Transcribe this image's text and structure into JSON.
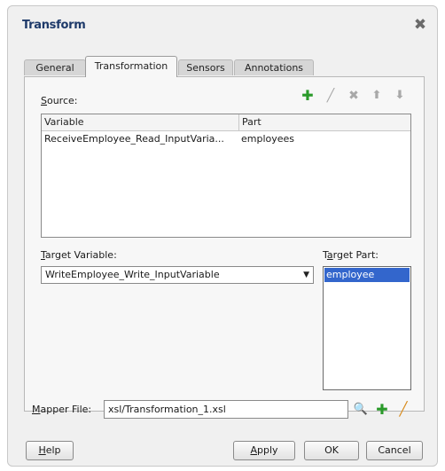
{
  "dialog": {
    "title": "Transform",
    "close_glyph": "✖"
  },
  "tabs": [
    {
      "label": "General"
    },
    {
      "label": "Transformation",
      "active": true
    },
    {
      "label": "Sensors"
    },
    {
      "label": "Annotations"
    }
  ],
  "source": {
    "label_accel": "S",
    "label_rest": "ource:",
    "toolbar": {
      "add_glyph": "✚",
      "edit_glyph": "╱",
      "delete_glyph": "✖",
      "up_glyph": "⬆",
      "down_glyph": "⬇"
    },
    "columns": [
      "Variable",
      "Part"
    ],
    "rows": [
      {
        "variable": "ReceiveEmployee_Read_InputVaria...",
        "part": "employees"
      }
    ]
  },
  "target_variable": {
    "label_accel": "T",
    "label_rest": "arget Variable:",
    "value": "WriteEmployee_Write_InputVariable",
    "arrow": "▼"
  },
  "target_part": {
    "label_pre": "T",
    "label_accel": "a",
    "label_rest": "rget Part:",
    "items": [
      "employee"
    ]
  },
  "mapper_file": {
    "label_accel": "M",
    "label_rest": "apper File:",
    "value": "xsl/Transformation_1.xsl",
    "search_glyph": "🔍",
    "add_glyph": "✚",
    "edit_glyph": "╱"
  },
  "buttons": {
    "help_accel": "H",
    "help_rest": "elp",
    "apply_accel": "A",
    "apply_rest": "pply",
    "ok": "OK",
    "cancel": "Cancel"
  },
  "colors": {
    "title": "#1e3a6a",
    "add_green": "#2a9a2a",
    "edit_orange": "#d88a1a",
    "disabled_grey": "#a8a8a8",
    "selection_blue": "#3366cc"
  }
}
